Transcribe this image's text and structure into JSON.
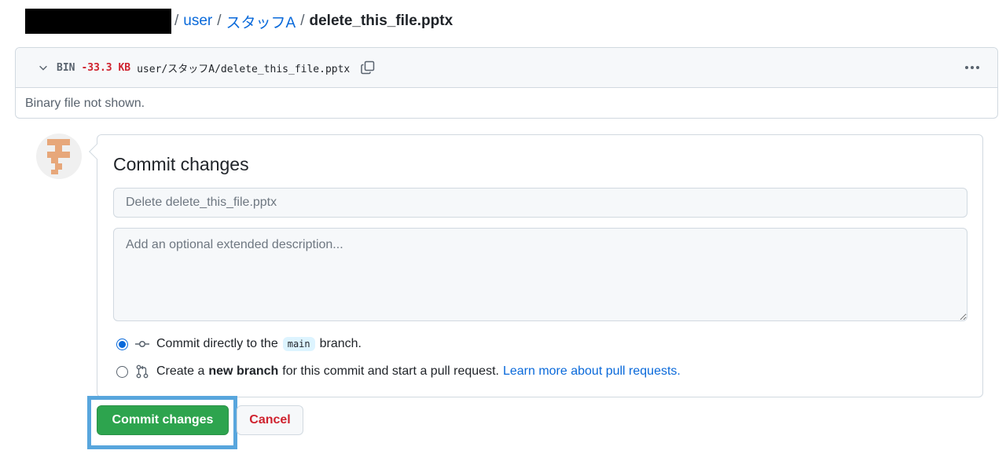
{
  "breadcrumb": {
    "sep": "/",
    "items": [
      "user",
      "スタッフA"
    ],
    "current": "delete_this_file.pptx"
  },
  "file": {
    "type_label": "BIN",
    "size_change": "-33.3 KB",
    "path": "user/スタッフA/delete_this_file.pptx",
    "body_text": "Binary file not shown."
  },
  "commit": {
    "title": "Commit changes",
    "summary_placeholder": "Delete delete_this_file.pptx",
    "description_placeholder": "Add an optional extended description...",
    "option_direct": {
      "prefix": "Commit directly to the",
      "branch": "main",
      "suffix": "branch."
    },
    "option_new_branch": {
      "prefix": "Create a",
      "bold": "new branch",
      "suffix": "for this commit and start a pull request.",
      "link": "Learn more about pull requests."
    },
    "selected_option": "direct"
  },
  "buttons": {
    "commit": "Commit changes",
    "cancel": "Cancel"
  },
  "colors": {
    "primary_button": "#2da44e",
    "danger_text": "#cf222e",
    "link": "#0969da",
    "highlight_border": "#58a6dd"
  }
}
